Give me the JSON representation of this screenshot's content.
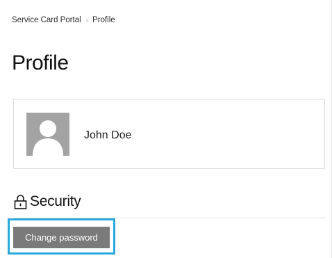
{
  "breadcrumb": {
    "root": "Service Card Portal",
    "separator": "›",
    "current": "Profile"
  },
  "page": {
    "title": "Profile"
  },
  "profile": {
    "avatar_icon": "user-silhouette-icon",
    "name": "John Doe"
  },
  "security": {
    "icon": "lock-icon",
    "heading": "Security",
    "change_password_label": "Change password"
  },
  "colors": {
    "button_bg": "#7a7a7a",
    "highlight_border": "#29a8dc",
    "avatar_bg": "#a3a3a3"
  }
}
